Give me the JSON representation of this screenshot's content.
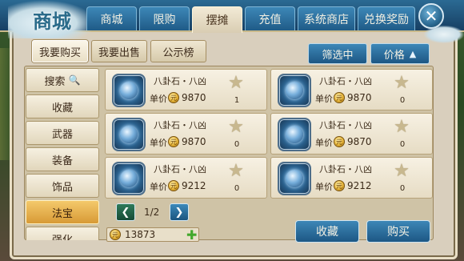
{
  "header": {
    "logo_text": "商城",
    "tabs": [
      {
        "label": "商城"
      },
      {
        "label": "限购"
      },
      {
        "label": "摆摊"
      },
      {
        "label": "充值"
      },
      {
        "label": "系统商店"
      },
      {
        "label": "兑换奖励"
      }
    ],
    "active_tab": "摆摊",
    "close_icon": "close-icon"
  },
  "subtabs": [
    {
      "label": "我要购买"
    },
    {
      "label": "我要出售"
    },
    {
      "label": "公示榜"
    }
  ],
  "toolbar": {
    "filter_label": "筛选中",
    "price_label": "价格",
    "price_sort_icon": "sort-up-icon"
  },
  "categories": [
    {
      "label": "搜索"
    },
    {
      "label": "收藏"
    },
    {
      "label": "武器"
    },
    {
      "label": "装备"
    },
    {
      "label": "饰品"
    },
    {
      "label": "法宝"
    },
    {
      "label": "强化"
    }
  ],
  "selected_category": "法宝",
  "items": [
    {
      "name": "八卦石・八凶",
      "unit_label": "单价",
      "price": "9870",
      "fav_count": "1"
    },
    {
      "name": "八卦石・八凶",
      "unit_label": "单价",
      "price": "9870",
      "fav_count": "0"
    },
    {
      "name": "八卦石・八凶",
      "unit_label": "单价",
      "price": "9870",
      "fav_count": "0"
    },
    {
      "name": "八卦石・八凶",
      "unit_label": "单价",
      "price": "9870",
      "fav_count": "0"
    },
    {
      "name": "八卦石・八凶",
      "unit_label": "单价",
      "price": "9212",
      "fav_count": "0"
    },
    {
      "name": "八卦石・八凶",
      "unit_label": "单价",
      "price": "9212",
      "fav_count": "0"
    }
  ],
  "pager": {
    "text": "1/2"
  },
  "balance": {
    "value": "13873"
  },
  "actions": {
    "favorite_label": "收藏",
    "buy_label": "购买"
  },
  "colors": {
    "tab_blue": "#1f5b87",
    "panel_beige": "#d9cfbd",
    "selected_gold": "#d89a36"
  }
}
